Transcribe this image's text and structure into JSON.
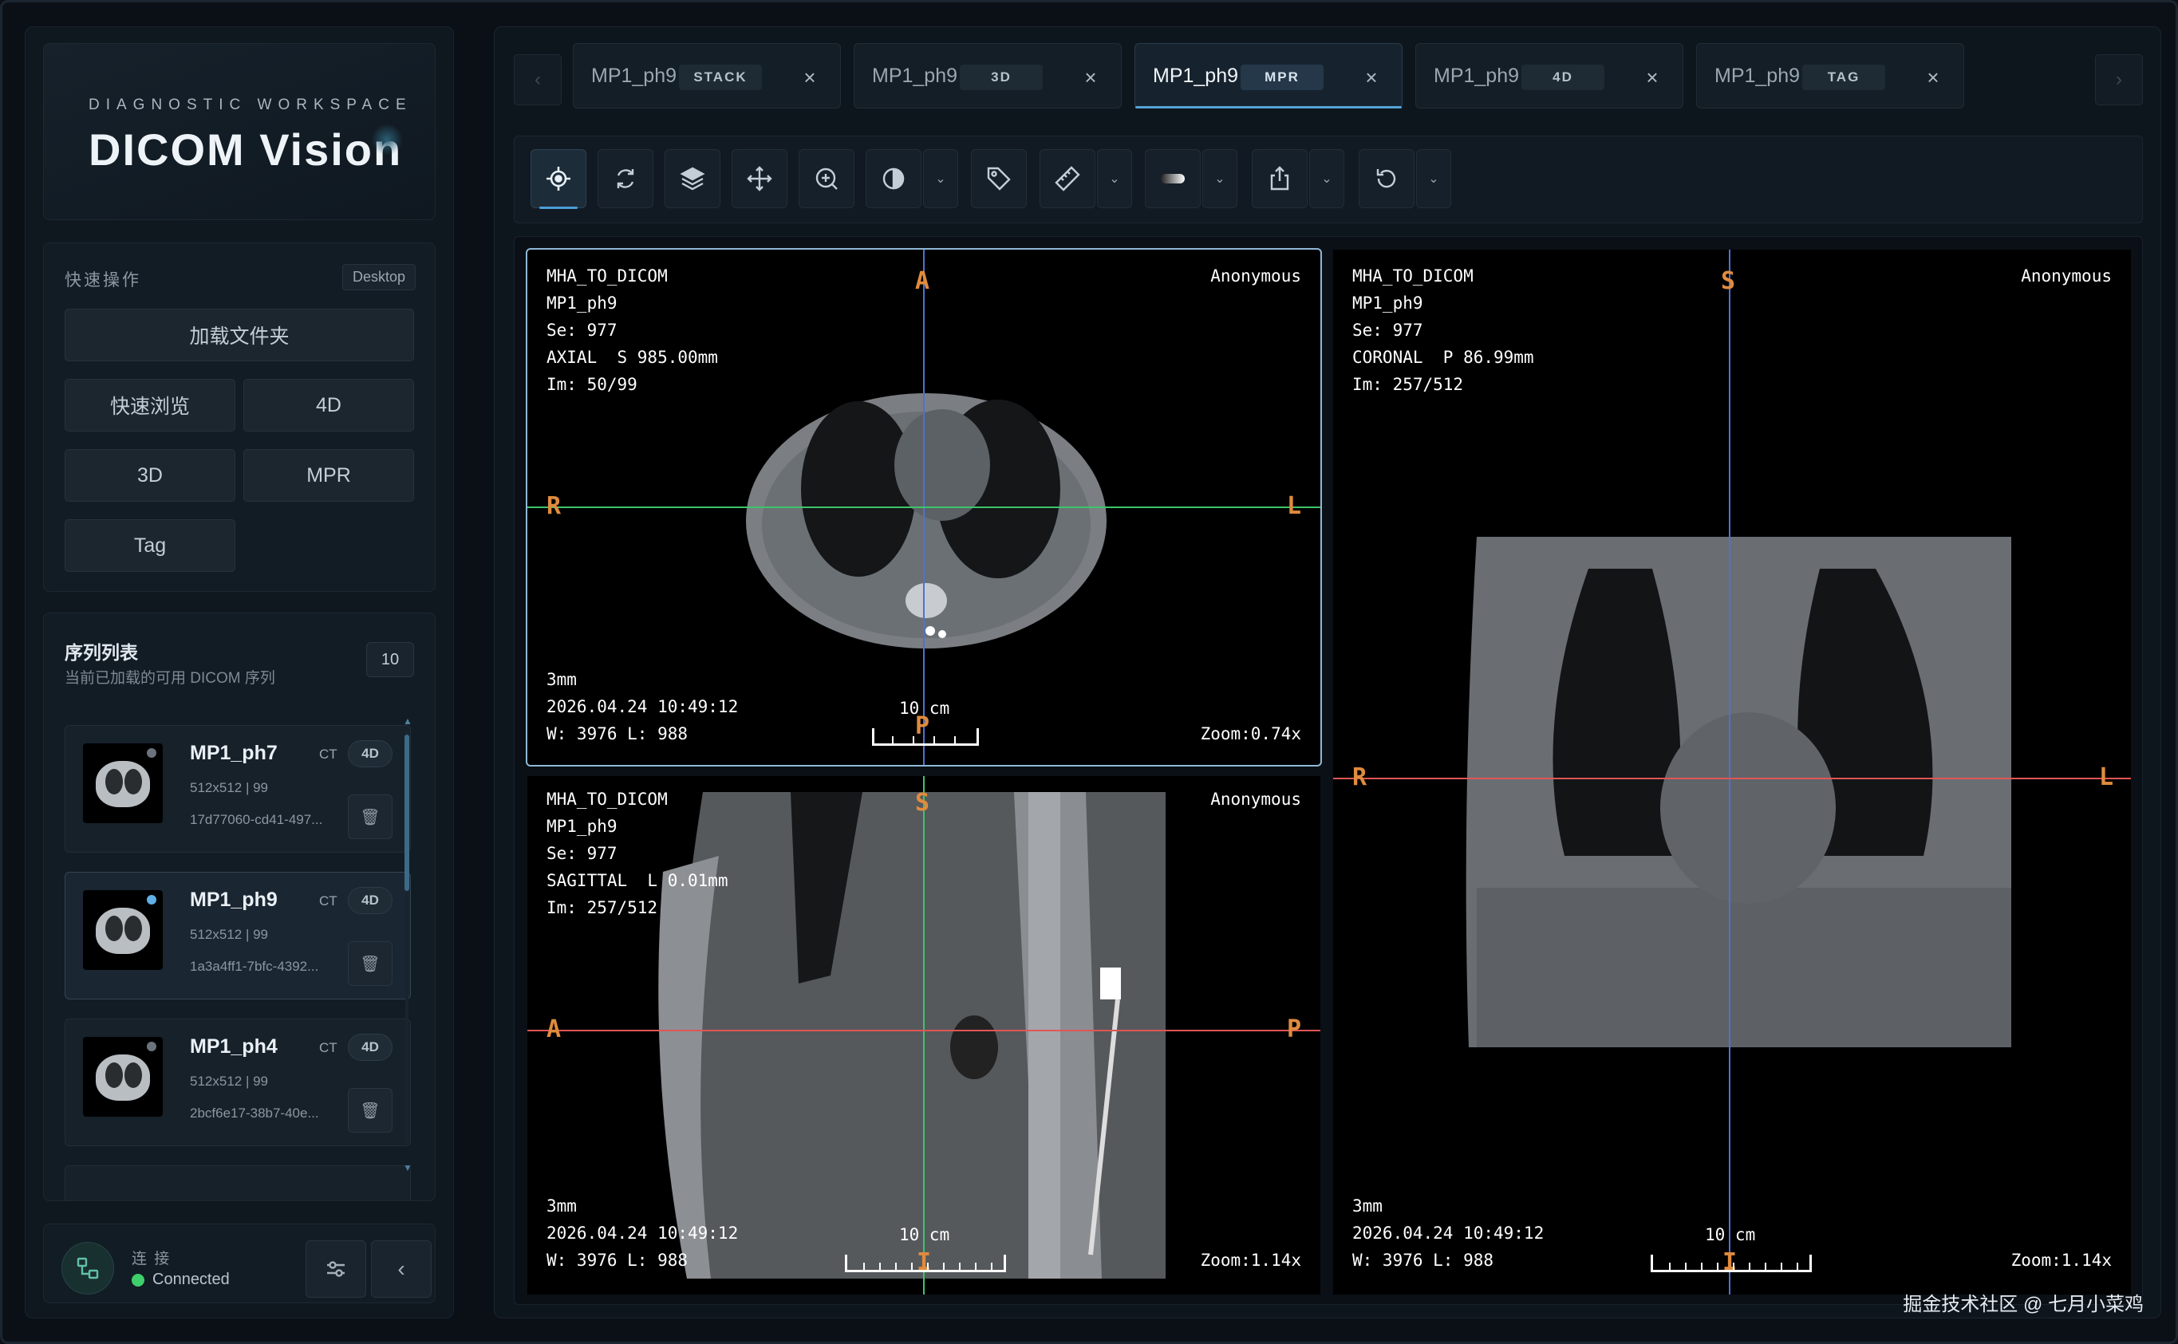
{
  "brand": {
    "subtitle": "DIAGNOSTIC WORKSPACE",
    "title": "DICOM Vision"
  },
  "quick": {
    "heading": "快速操作",
    "badge": "Desktop",
    "load_folder": "加载文件夹",
    "buttons": [
      "快速浏览",
      "4D",
      "3D",
      "MPR",
      "Tag"
    ]
  },
  "series": {
    "heading": "序列列表",
    "subheading": "当前已加载的可用 DICOM 序列",
    "count": "10",
    "items": [
      {
        "name": "MP1_ph7",
        "modality": "CT",
        "tag": "4D",
        "meta": "512x512 | 99",
        "uid": "17d77060-cd41-497..."
      },
      {
        "name": "MP1_ph9",
        "modality": "CT",
        "tag": "4D",
        "meta": "512x512 | 99",
        "uid": "1a3a4ff1-7bfc-4392..."
      },
      {
        "name": "MP1_ph4",
        "modality": "CT",
        "tag": "4D",
        "meta": "512x512 | 99",
        "uid": "2bcf6e17-38b7-40e..."
      }
    ]
  },
  "status": {
    "label": "连 接",
    "state": "Connected",
    "state_color": "#3ecf6b"
  },
  "tabs": [
    {
      "name": "MP1_ph9",
      "mode": "STACK"
    },
    {
      "name": "MP1_ph9",
      "mode": "3D"
    },
    {
      "name": "MP1_ph9",
      "mode": "MPR"
    },
    {
      "name": "MP1_ph9",
      "mode": "4D"
    },
    {
      "name": "MP1_ph9",
      "mode": "TAG"
    }
  ],
  "active_tab": "MPR",
  "toolbar": {
    "tools": [
      "crosshair-icon",
      "rotate-icon",
      "layers-icon",
      "pan-icon",
      "zoom-icon",
      "contrast-icon",
      "tag-icon",
      "ruler-icon",
      "gradient-icon",
      "export-icon",
      "reset-icon"
    ]
  },
  "viewports": {
    "axial": {
      "tl": "MHA_TO_DICOM\nMP1_ph9\nSe: 977\nAXIAL  S 985.00mm\nIm: 50/99",
      "tr": "Anonymous",
      "bl": "3mm\n2026.04.24 10:49:12\nW: 3976 L: 988",
      "br": "Zoom:0.74x",
      "scale": "10 cm",
      "dirs": {
        "top": "A",
        "bottom": "P",
        "left": "R",
        "right": "L"
      }
    },
    "sagittal": {
      "tl": "MHA_TO_DICOM\nMP1_ph9\nSe: 977\nSAGITTAL  L 0.01mm\nIm: 257/512",
      "tr": "Anonymous",
      "bl": "3mm\n2026.04.24 10:49:12\nW: 3976 L: 988",
      "br": "Zoom:1.14x",
      "scale": "10 cm",
      "dirs": {
        "top": "S",
        "left": "A",
        "right": "P",
        "bottom": "I"
      }
    },
    "coronal": {
      "tl": "MHA_TO_DICOM\nMP1_ph9\nSe: 977\nCORONAL  P 86.99mm\nIm: 257/512",
      "tr": "Anonymous",
      "bl": "3mm\n2026.04.24 10:49:12\nW: 3976 L: 988",
      "br": "Zoom:1.14x",
      "scale": "10 cm",
      "dirs": {
        "top": "S",
        "left": "R",
        "right": "L",
        "bottom": "I"
      }
    }
  },
  "colors": {
    "accent": "#55a3d6",
    "crosshair_axial": "#4a90e2",
    "crosshair_coronal": "#e05555",
    "crosshair_sagittal": "#3ec46a",
    "orientation": "#e08b3e"
  },
  "watermark": "掘金技术社区 @ 七月小菜鸡"
}
